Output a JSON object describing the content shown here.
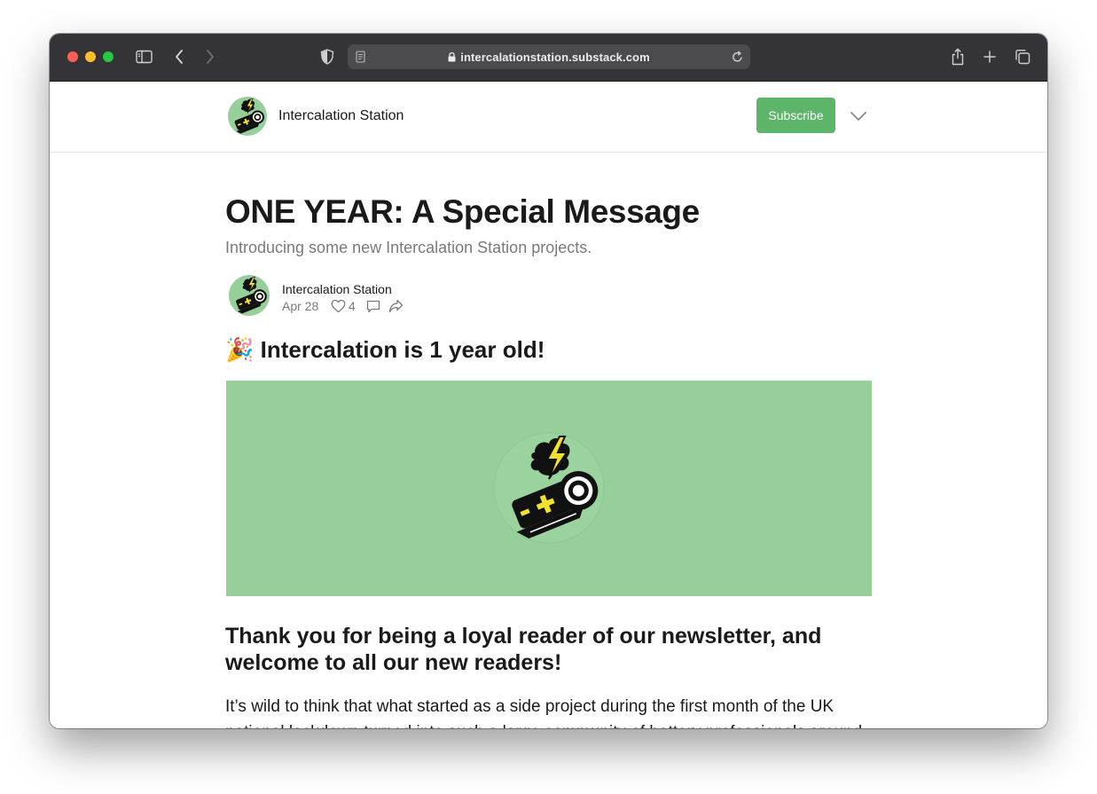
{
  "browser": {
    "url": "intercalationstation.substack.com"
  },
  "header": {
    "site_name": "Intercalation Station",
    "subscribe_label": "Subscribe"
  },
  "post": {
    "title": "ONE YEAR: A Special Message",
    "subtitle": "Introducing some new Intercalation Station projects.",
    "author": "Intercalation Station",
    "date": "Apr 28",
    "likes": "4",
    "section_heading_emoji": "🎉",
    "section_heading": "Intercalation is 1 year old!",
    "thank_you_line1": "Thank you for being a loyal reader of our newsletter, and",
    "thank_you_line2": "welcome to all our new readers!",
    "body_line1": "It’s wild to think that what started as a side project during the first month of the UK",
    "body_line2": "national lockdown turned into such a large community of battery professionals around"
  },
  "colors": {
    "accent": "#5db56a",
    "logo_background": "#96cf9a",
    "toolbar": "#343338"
  }
}
